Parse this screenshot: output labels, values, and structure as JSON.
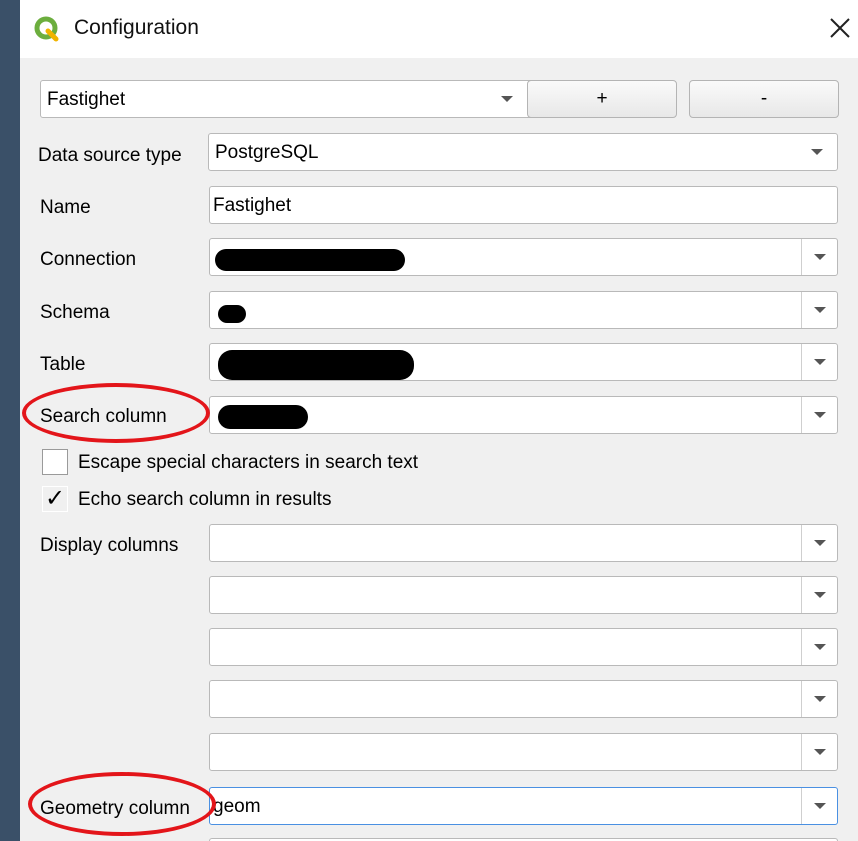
{
  "dialog": {
    "title": "Configuration"
  },
  "top": {
    "profile_value": "Fastighet",
    "add_label": "+",
    "remove_label": "-"
  },
  "form": {
    "datasource": {
      "label": "Data source type",
      "value": "PostgreSQL"
    },
    "name": {
      "label": "Name",
      "value": "Fastighet"
    },
    "connection": {
      "label": "Connection"
    },
    "schema": {
      "label": "Schema"
    },
    "table": {
      "label": "Table"
    },
    "search_column": {
      "label": "Search column"
    },
    "escape_check": {
      "label": "Escape special characters in search text",
      "checked": false
    },
    "echo_check": {
      "label": "Echo search column in results",
      "checked": true,
      "mark": "✓"
    },
    "display_columns": {
      "label": "Display columns",
      "values": [
        "",
        "",
        "",
        "",
        ""
      ]
    },
    "geometry_column": {
      "label": "Geometry column",
      "value": "geom"
    }
  },
  "colors": {
    "annotation": "#e3151a",
    "focus": "#4a90e2"
  }
}
